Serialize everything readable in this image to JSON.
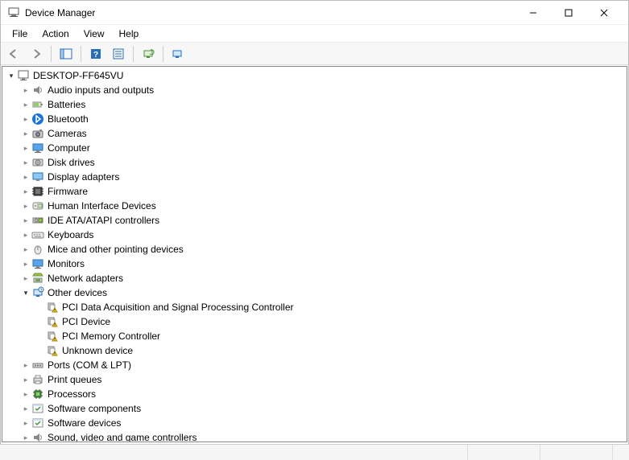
{
  "window": {
    "title": "Device Manager"
  },
  "menu": {
    "file": "File",
    "action": "Action",
    "view": "View",
    "help": "Help"
  },
  "tree": {
    "root_label": "DESKTOP-FF645VU",
    "categories": [
      {
        "label": "Audio inputs and outputs",
        "expanded": false,
        "has_children": true
      },
      {
        "label": "Batteries",
        "expanded": false,
        "has_children": true
      },
      {
        "label": "Bluetooth",
        "expanded": false,
        "has_children": true
      },
      {
        "label": "Cameras",
        "expanded": false,
        "has_children": true
      },
      {
        "label": "Computer",
        "expanded": false,
        "has_children": true
      },
      {
        "label": "Disk drives",
        "expanded": false,
        "has_children": true
      },
      {
        "label": "Display adapters",
        "expanded": false,
        "has_children": true
      },
      {
        "label": "Firmware",
        "expanded": false,
        "has_children": true
      },
      {
        "label": "Human Interface Devices",
        "expanded": false,
        "has_children": true
      },
      {
        "label": "IDE ATA/ATAPI controllers",
        "expanded": false,
        "has_children": true
      },
      {
        "label": "Keyboards",
        "expanded": false,
        "has_children": true
      },
      {
        "label": "Mice and other pointing devices",
        "expanded": false,
        "has_children": true
      },
      {
        "label": "Monitors",
        "expanded": false,
        "has_children": true
      },
      {
        "label": "Network adapters",
        "expanded": false,
        "has_children": true
      },
      {
        "label": "Other devices",
        "expanded": true,
        "has_children": true,
        "children": [
          "PCI Data Acquisition and Signal Processing Controller",
          "PCI Device",
          "PCI Memory Controller",
          "Unknown device"
        ]
      },
      {
        "label": "Ports (COM & LPT)",
        "expanded": false,
        "has_children": true
      },
      {
        "label": "Print queues",
        "expanded": false,
        "has_children": true
      },
      {
        "label": "Processors",
        "expanded": false,
        "has_children": true
      },
      {
        "label": "Software components",
        "expanded": false,
        "has_children": true
      },
      {
        "label": "Software devices",
        "expanded": false,
        "has_children": true
      },
      {
        "label": "Sound, video and game controllers",
        "expanded": false,
        "has_children": true
      }
    ]
  }
}
